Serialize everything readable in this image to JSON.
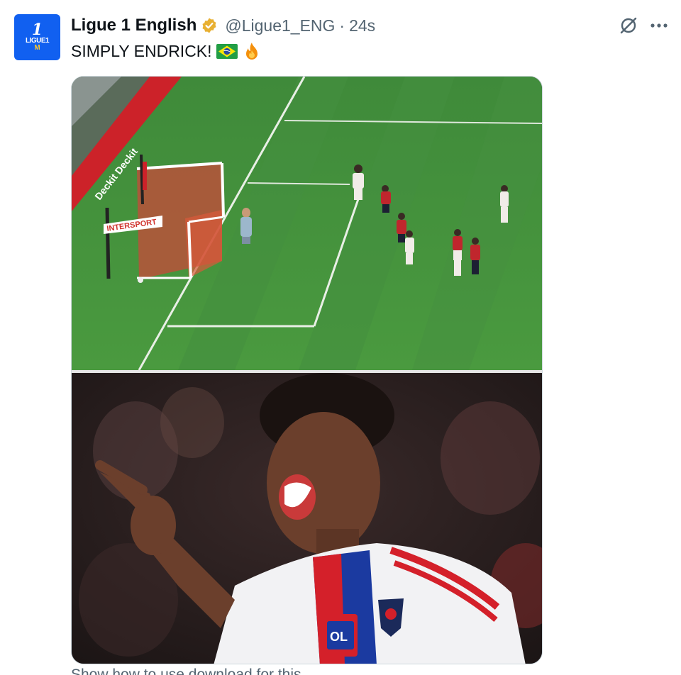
{
  "account": {
    "display_name": "Ligue 1 English",
    "handle": "@Ligue1_ENG",
    "separator": "·",
    "timestamp": "24s",
    "verified": true,
    "verified_color": "#e8b032",
    "avatar_icon": "ligue1-logo-icon",
    "avatar_color": "#1160f0",
    "avatar_text": {
      "number": "1",
      "label": "LIGUE1",
      "mark": "M"
    }
  },
  "tweet": {
    "text": "SIMPLY ENDRICK!",
    "emojis": [
      "brazil-flag-icon",
      "fire-icon"
    ]
  },
  "actions": {
    "grok_icon": "grok-icon",
    "more_icon": "more-options-icon"
  },
  "media": {
    "photos": [
      {
        "name": "goal-scene-photo",
        "banners": [
          "INTERSPORT"
        ]
      },
      {
        "name": "celebration-photo",
        "jersey_badge": "OL"
      }
    ]
  },
  "footer": {
    "cut_text": "Show how to use download for this"
  }
}
